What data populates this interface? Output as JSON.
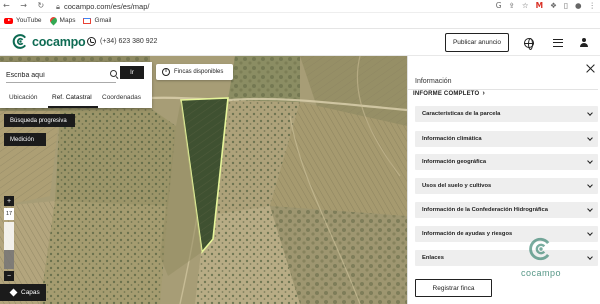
{
  "browser": {
    "nav_glyphs": "← → ↻",
    "url": "cocampo.com/es/es/map/",
    "actions": [
      "G",
      "⇪",
      "☆",
      "♪",
      "❖",
      "▯",
      "●",
      "⋮"
    ],
    "extension_badge": "M",
    "bookmarks": [
      {
        "label": "YouTube",
        "icon": "youtube-icon"
      },
      {
        "label": "Maps",
        "icon": "maps-icon"
      },
      {
        "label": "Gmail",
        "icon": "gmail-icon"
      }
    ]
  },
  "header": {
    "logo": "cocampo",
    "phone": "(+34) 623 380 922",
    "publish_button": "Publicar anuncio",
    "brand_color": "#0e6b53"
  },
  "search": {
    "placeholder": "Escriba aquí",
    "go_button": "Ir",
    "tabs": [
      {
        "label": "Ubicación",
        "active": false
      },
      {
        "label": "Ref. Catastral",
        "active": true
      },
      {
        "label": "Coordenadas",
        "active": false
      }
    ]
  },
  "map": {
    "fincas_chip": "Fincas disponibles",
    "busqueda_button": "Búsqueda progresiva",
    "medicion_button": "Medición",
    "zoom_in": "+",
    "zoom_out": "−",
    "zoom_level": "17",
    "layers_button": "Capas",
    "parcel_outline_color": "#e6f59a"
  },
  "panel": {
    "title": "Información",
    "report_link": "INFORME COMPLETO",
    "sections": [
      "Características de la parcela",
      "Información climática",
      "Información geográfica",
      "Usos del suelo y cultivos",
      "Información de la Confederación Hidrográfica",
      "Información de ayudas y riesgos",
      "Enlaces"
    ],
    "register_button": "Registrar finca",
    "watermark": "cocampo"
  }
}
